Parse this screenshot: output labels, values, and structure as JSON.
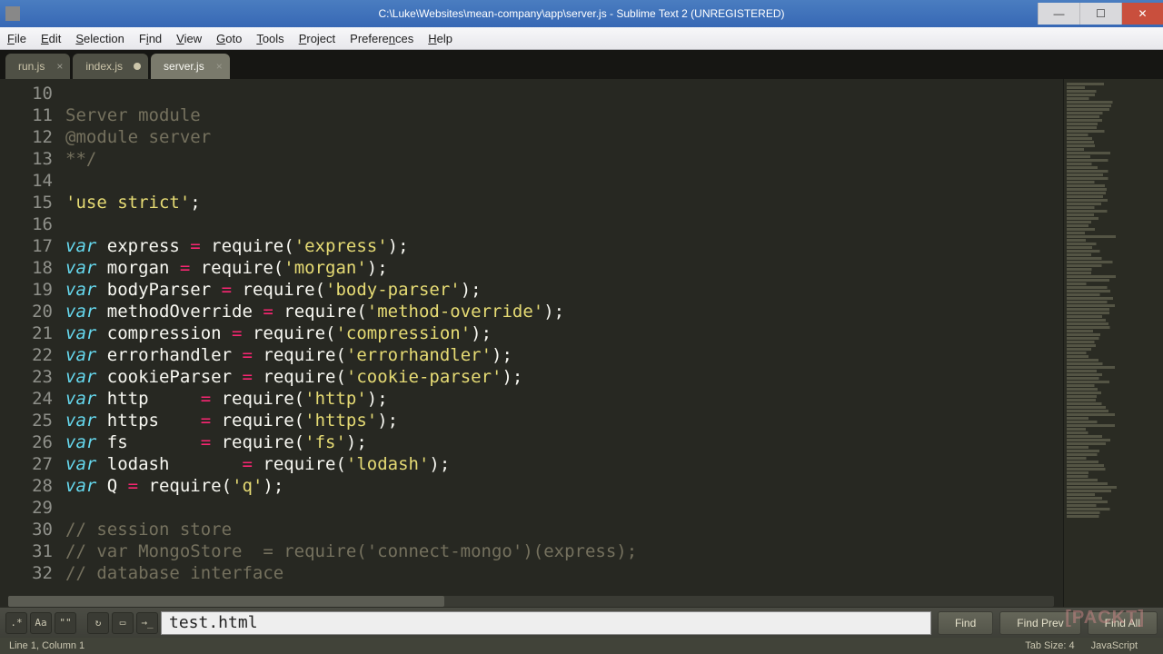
{
  "window": {
    "title": "C:\\Luke\\Websites\\mean-company\\app\\server.js - Sublime Text 2 (UNREGISTERED)"
  },
  "menus": {
    "file": "File",
    "edit": "Edit",
    "selection": "Selection",
    "find": "Find",
    "view": "View",
    "goto": "Goto",
    "tools": "Tools",
    "project": "Project",
    "preferences": "Preferences",
    "help": "Help"
  },
  "tabs": {
    "t0": {
      "label": "run.js",
      "dirty": false,
      "active": false
    },
    "t1": {
      "label": "index.js",
      "dirty": true,
      "active": false
    },
    "t2": {
      "label": "server.js",
      "dirty": false,
      "active": true
    }
  },
  "gutter_start": 10,
  "code_lines": {
    "l10": "",
    "l11": "Server module",
    "l12": "@module server",
    "l13": "**/",
    "l14": "",
    "l15_a": "'use strict'",
    "l15_b": ";",
    "l16": "",
    "l17_v": "var",
    "l17_n": " express ",
    "l17_e": "=",
    "l17_r": " require(",
    "l17_s": "'express'",
    "l17_c": ");",
    "l18_v": "var",
    "l18_n": " morgan ",
    "l18_e": "=",
    "l18_r": " require(",
    "l18_s": "'morgan'",
    "l18_c": ");",
    "l19_v": "var",
    "l19_n": " bodyParser ",
    "l19_e": "=",
    "l19_r": " require(",
    "l19_s": "'body-parser'",
    "l19_c": ");",
    "l20_v": "var",
    "l20_n": " methodOverride ",
    "l20_e": "=",
    "l20_r": " require(",
    "l20_s": "'method-override'",
    "l20_c": ");",
    "l21_v": "var",
    "l21_n": " compression ",
    "l21_e": "=",
    "l21_r": " require(",
    "l21_s": "'compression'",
    "l21_c": ");",
    "l22_v": "var",
    "l22_n": " errorhandler ",
    "l22_e": "=",
    "l22_r": " require(",
    "l22_s": "'errorhandler'",
    "l22_c": ");",
    "l23_v": "var",
    "l23_n": " cookieParser ",
    "l23_e": "=",
    "l23_r": " require(",
    "l23_s": "'cookie-parser'",
    "l23_c": ");",
    "l24_v": "var",
    "l24_n": " http     ",
    "l24_e": "=",
    "l24_r": " require(",
    "l24_s": "'http'",
    "l24_c": ");",
    "l25_v": "var",
    "l25_n": " https    ",
    "l25_e": "=",
    "l25_r": " require(",
    "l25_s": "'https'",
    "l25_c": ");",
    "l26_v": "var",
    "l26_n": " fs       ",
    "l26_e": "=",
    "l26_r": " require(",
    "l26_s": "'fs'",
    "l26_c": ");",
    "l27_v": "var",
    "l27_n": " lodash       ",
    "l27_e": "=",
    "l27_r": " require(",
    "l27_s": "'lodash'",
    "l27_c": ");",
    "l28_v": "var",
    "l28_n": " Q ",
    "l28_e": "=",
    "l28_r": " require(",
    "l28_s": "'q'",
    "l28_c": ");",
    "l29": "",
    "l30": "// session store",
    "l31": "// var MongoStore  = require('connect-mongo')(express);",
    "l32": "// database interface"
  },
  "find": {
    "placeholder": "",
    "value": "test.html",
    "btn_find": "Find",
    "btn_prev": "Find Prev",
    "btn_all": "Find All"
  },
  "status": {
    "pos": "Line 1, Column 1",
    "tabsize": "Tab Size: 4",
    "syntax": "JavaScript"
  },
  "watermark": "[PACKT]"
}
